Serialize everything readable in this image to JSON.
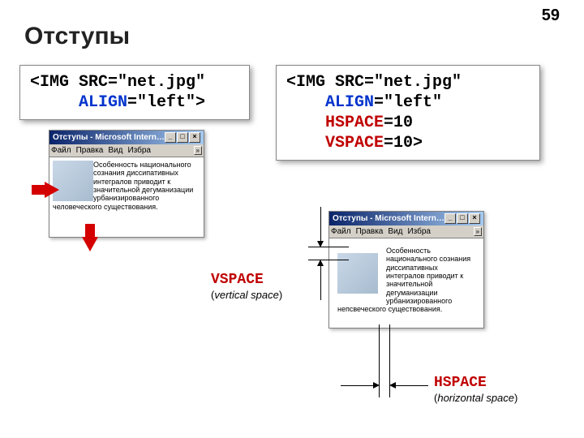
{
  "page_number": "59",
  "title": "Отступы",
  "code_left": {
    "line1": "<IMG SRC=\"net.jpg\"",
    "line2_indent": "     ",
    "align_attr": "ALIGN",
    "align_rest": "=\"left\">"
  },
  "code_right": {
    "line1": "<IMG SRC=\"net.jpg\"",
    "line2_indent": "    ",
    "align_attr": "ALIGN",
    "align_rest": "=\"left\"",
    "hspace_attr": "HSPACE",
    "hspace_rest": "=10",
    "vspace_attr": "VSPACE",
    "vspace_rest": "=10>"
  },
  "browser": {
    "title": "Отступы - Microsoft Intern…",
    "menus": [
      "Файл",
      "Правка",
      "Вид",
      "Избра"
    ],
    "chevron": "»",
    "min_btn": "_",
    "max_btn": "□",
    "close_btn": "×",
    "sample_text": "Особенность национального сознания диссипативных интегралов приводит к значительной дегуманизации урбанизированного человеческого существования.",
    "sample_text_pad": "Особенность национального сознания диссипативных интегралов приводит к значительной дегуманизации урбанизированного непсвеческого существования."
  },
  "labels": {
    "vspace": "VSPACE",
    "vspace_desc_open": "(",
    "vspace_desc_i": "vertical space",
    "vspace_desc_close": ")",
    "hspace": "HSPACE",
    "hspace_desc_open": "(",
    "hspace_desc_i": "horizontal space",
    "hspace_desc_close": ")"
  }
}
